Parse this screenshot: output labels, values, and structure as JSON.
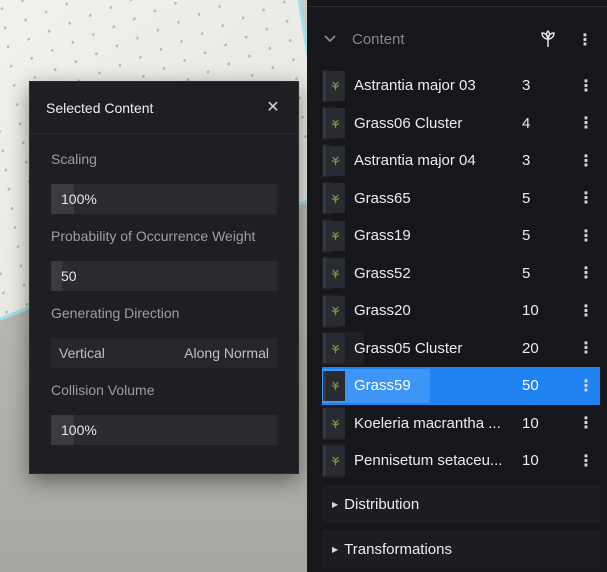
{
  "popover": {
    "title": "Selected Content",
    "close_icon": "close-icon",
    "fields": {
      "scaling": {
        "label": "Scaling",
        "value": "100%",
        "level": 0.1
      },
      "probability": {
        "label": "Probability of Occurrence Weight",
        "value": "50",
        "level": 0.05
      },
      "direction": {
        "label": "Generating Direction",
        "options": [
          "Vertical",
          "Along Normal"
        ]
      },
      "collision": {
        "label": "Collision Volume",
        "value": "100%",
        "level": 0.1
      }
    }
  },
  "panel": {
    "section": {
      "title": "Content",
      "chevron_icon": "chevron-down-icon",
      "action_icon": "plant-icon",
      "menu_icon": "more-vertical-icon"
    },
    "items": [
      {
        "name": "Astrantia major 03",
        "count": "3"
      },
      {
        "name": "Grass06 Cluster",
        "count": "4"
      },
      {
        "name": "Astrantia major 04",
        "count": "3"
      },
      {
        "name": "Grass65",
        "count": "5"
      },
      {
        "name": "Grass19",
        "count": "5"
      },
      {
        "name": "Grass52",
        "count": "5"
      },
      {
        "name": "Grass20",
        "count": "10"
      },
      {
        "name": "Grass05 Cluster",
        "count": "20"
      },
      {
        "name": "Grass59",
        "count": "50",
        "selected": true
      },
      {
        "name": "Koeleria macrantha ...",
        "count": "10"
      },
      {
        "name": "Pennisetum setaceu...",
        "count": "10"
      }
    ],
    "distribution": {
      "title": "Distribution"
    },
    "transformations": {
      "title": "Transformations"
    }
  },
  "colors": {
    "accent": "#1f83f2",
    "panel_bg": "#16171b",
    "popover_bg": "#1e1f23"
  }
}
